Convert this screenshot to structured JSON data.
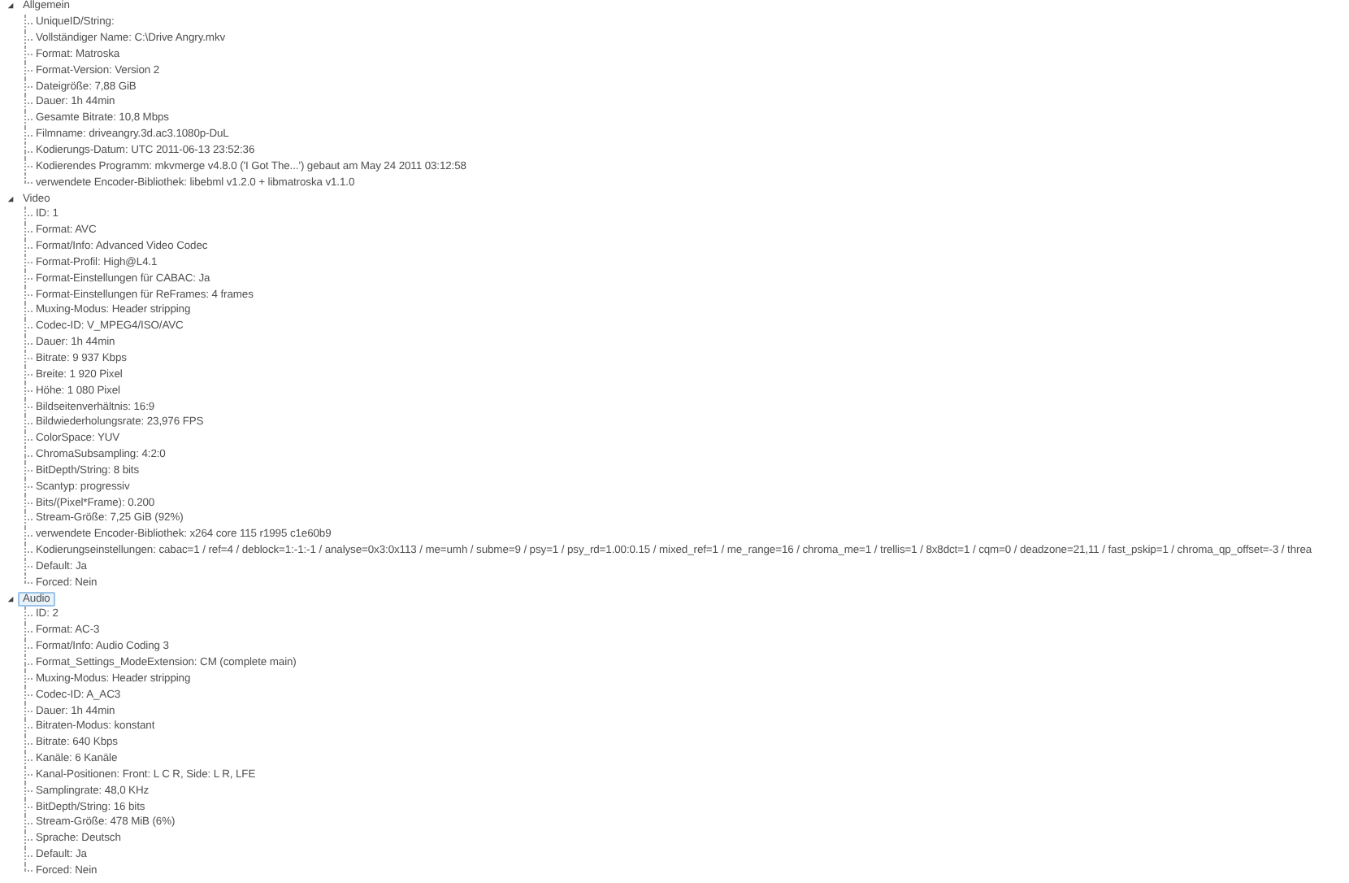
{
  "tree": [
    {
      "label": "Allgemein",
      "expanded": true,
      "selected": false,
      "children": [
        {
          "label": "UniqueID/String:"
        },
        {
          "label": "Vollständiger Name: C:\\Drive Angry.mkv"
        },
        {
          "label": "Format: Matroska"
        },
        {
          "label": "Format-Version: Version 2"
        },
        {
          "label": "Dateigröße: 7,88 GiB"
        },
        {
          "label": "Dauer: 1h 44min"
        },
        {
          "label": "Gesamte Bitrate: 10,8 Mbps"
        },
        {
          "label": "Filmname: driveangry.3d.ac3.1080p-DuL"
        },
        {
          "label": "Kodierungs-Datum: UTC 2011-06-13 23:52:36"
        },
        {
          "label": "Kodierendes Programm: mkvmerge v4.8.0 ('I Got The...') gebaut am May 24 2011 03:12:58"
        },
        {
          "label": "verwendete Encoder-Bibliothek: libebml v1.2.0 + libmatroska v1.1.0"
        }
      ]
    },
    {
      "label": "Video",
      "expanded": true,
      "selected": false,
      "children": [
        {
          "label": "ID: 1"
        },
        {
          "label": "Format: AVC"
        },
        {
          "label": "Format/Info: Advanced Video Codec"
        },
        {
          "label": "Format-Profil: High@L4.1"
        },
        {
          "label": "Format-Einstellungen für CABAC: Ja"
        },
        {
          "label": "Format-Einstellungen für ReFrames: 4 frames"
        },
        {
          "label": "Muxing-Modus: Header stripping"
        },
        {
          "label": "Codec-ID: V_MPEG4/ISO/AVC"
        },
        {
          "label": "Dauer: 1h 44min"
        },
        {
          "label": "Bitrate: 9 937 Kbps"
        },
        {
          "label": "Breite: 1 920 Pixel"
        },
        {
          "label": "Höhe: 1 080 Pixel"
        },
        {
          "label": "Bildseitenverhältnis: 16:9"
        },
        {
          "label": "Bildwiederholungsrate: 23,976 FPS"
        },
        {
          "label": "ColorSpace: YUV"
        },
        {
          "label": "ChromaSubsampling: 4:2:0"
        },
        {
          "label": "BitDepth/String: 8 bits"
        },
        {
          "label": "Scantyp: progressiv"
        },
        {
          "label": "Bits/(Pixel*Frame): 0.200"
        },
        {
          "label": "Stream-Größe: 7,25 GiB (92%)"
        },
        {
          "label": "verwendete Encoder-Bibliothek: x264 core 115 r1995 c1e60b9"
        },
        {
          "label": "Kodierungseinstellungen: cabac=1 / ref=4 / deblock=1:-1:-1 / analyse=0x3:0x113 / me=umh / subme=9 / psy=1 / psy_rd=1.00:0.15 / mixed_ref=1 / me_range=16 / chroma_me=1 / trellis=1 / 8x8dct=1 / cqm=0 / deadzone=21,11 / fast_pskip=1 / chroma_qp_offset=-3 / threa"
        },
        {
          "label": "Default: Ja"
        },
        {
          "label": "Forced: Nein"
        }
      ]
    },
    {
      "label": "Audio",
      "expanded": true,
      "selected": true,
      "children": [
        {
          "label": "ID: 2"
        },
        {
          "label": "Format: AC-3"
        },
        {
          "label": "Format/Info: Audio Coding 3"
        },
        {
          "label": "Format_Settings_ModeExtension: CM (complete main)"
        },
        {
          "label": "Muxing-Modus: Header stripping"
        },
        {
          "label": "Codec-ID: A_AC3"
        },
        {
          "label": "Dauer: 1h 44min"
        },
        {
          "label": "Bitraten-Modus: konstant"
        },
        {
          "label": "Bitrate: 640 Kbps"
        },
        {
          "label": "Kanäle: 6 Kanäle"
        },
        {
          "label": "Kanal-Positionen: Front: L C R, Side: L R, LFE"
        },
        {
          "label": "Samplingrate: 48,0 KHz"
        },
        {
          "label": "BitDepth/String: 16 bits"
        },
        {
          "label": "Stream-Größe: 478 MiB (6%)"
        },
        {
          "label": "Sprache: Deutsch"
        },
        {
          "label": "Default: Ja"
        },
        {
          "label": "Forced: Nein"
        }
      ]
    }
  ]
}
